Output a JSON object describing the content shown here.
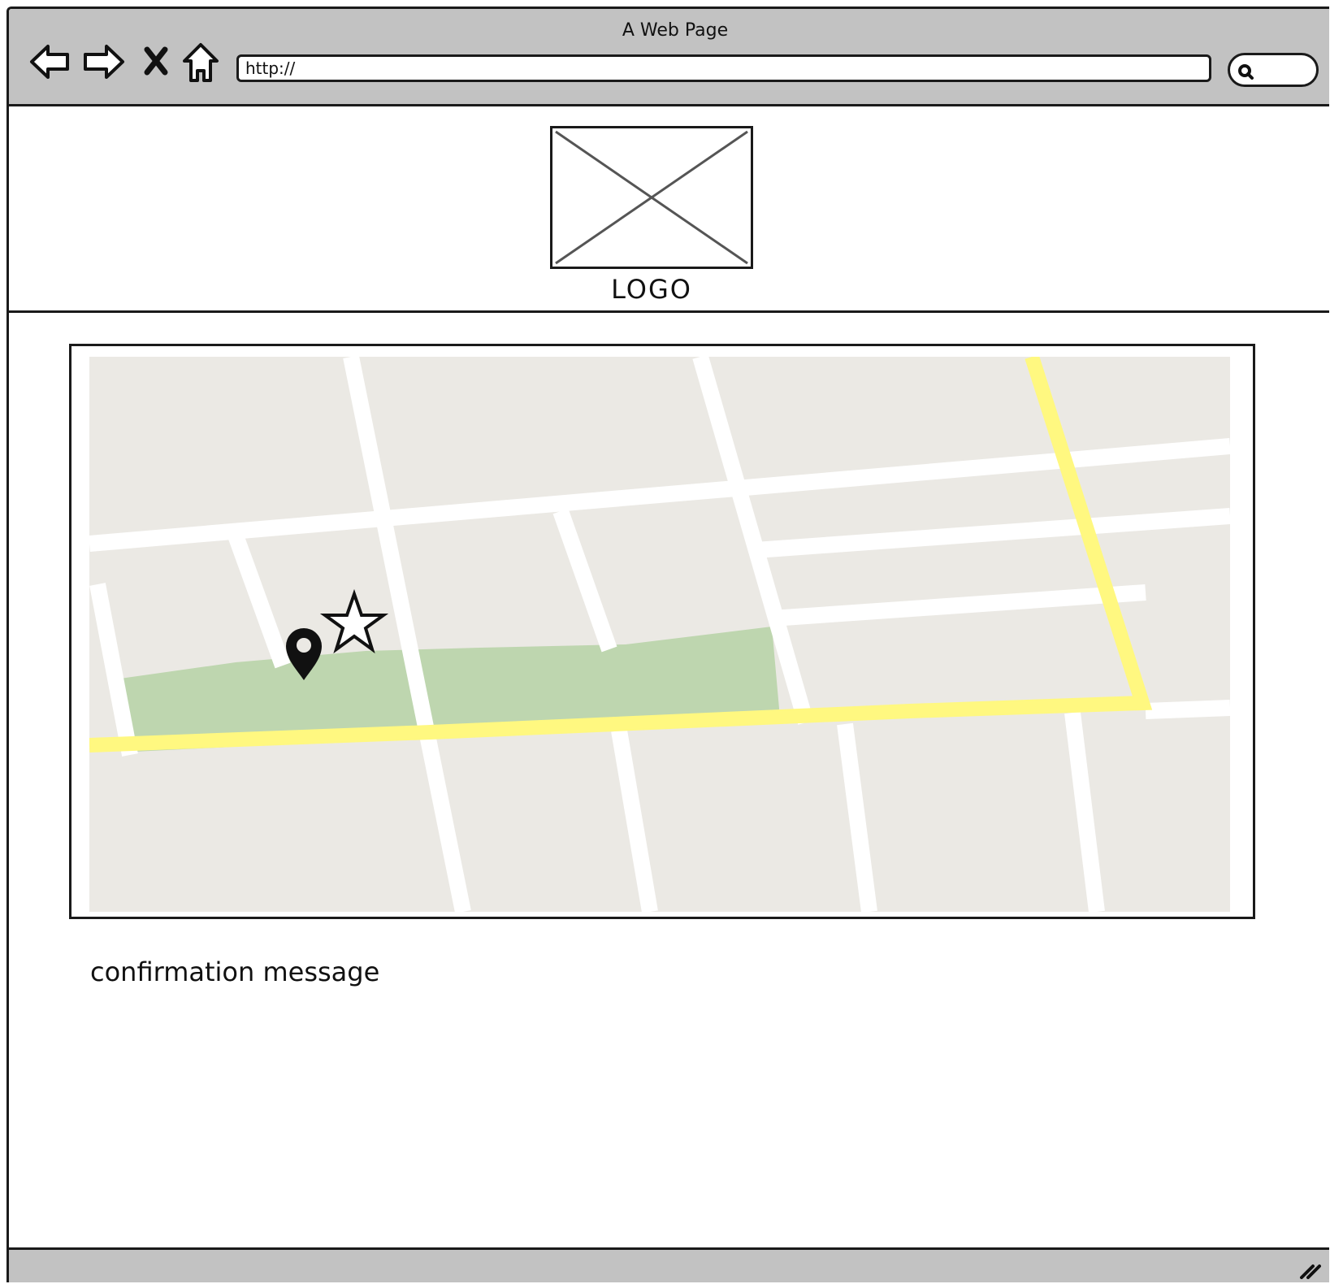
{
  "window": {
    "title": "A Web Page"
  },
  "toolbar": {
    "back_icon": "back-arrow-icon",
    "forward_icon": "forward-arrow-icon",
    "stop_icon": "close-icon",
    "home_icon": "home-icon",
    "url_value": "http://",
    "search_icon": "search-icon"
  },
  "header": {
    "logo_label": "LOGO"
  },
  "map": {
    "road_color": "#ffffff",
    "highway_color": "#fff880",
    "park_color": "#bed6af",
    "land_color": "#ebe9e4",
    "pin_icon": "map-pin-icon",
    "star_icon": "star-icon"
  },
  "content": {
    "confirmation_message": "confirmation message"
  },
  "statusbar": {
    "resize_icon": "resize-grip-icon"
  }
}
